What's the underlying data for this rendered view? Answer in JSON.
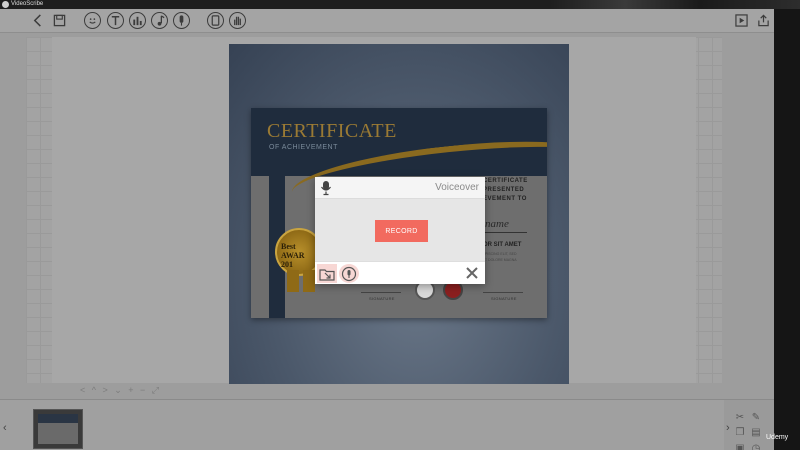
{
  "window": {
    "title": "VideoScribe"
  },
  "toolbar": {
    "left": [
      {
        "name": "back",
        "icon": "back-arrow-icon"
      },
      {
        "name": "save",
        "icon": "save-disk-icon"
      }
    ],
    "tools": [
      {
        "name": "add-image",
        "icon": "smiley-icon"
      },
      {
        "name": "add-text",
        "icon": "text-t-icon"
      },
      {
        "name": "add-chart",
        "icon": "bar-chart-icon"
      },
      {
        "name": "add-music",
        "icon": "music-note-icon"
      },
      {
        "name": "add-voiceover",
        "icon": "microphone-icon"
      },
      {
        "name": "background",
        "icon": "page-icon"
      },
      {
        "name": "hand",
        "icon": "hand-icon"
      }
    ],
    "right": [
      {
        "name": "play",
        "icon": "play-icon"
      },
      {
        "name": "publish",
        "icon": "share-upload-icon"
      }
    ]
  },
  "certificate": {
    "title": "CERTIFICATE",
    "subtitle": "OF ACHIEVEMENT",
    "right_lines": [
      "CERTIFICATE",
      "PRESENTED",
      "EVEMENT TO"
    ],
    "name": "name",
    "lorem": "OR SIT AMET",
    "small_lines": [
      "PISCING ELIT, SED",
      "T DOLORE MAGNA"
    ],
    "signature_label": "SIGNATURE",
    "medal_text": [
      "Best",
      "AWAR",
      "201"
    ]
  },
  "voiceover_dialog": {
    "title": "Voiceover",
    "record_label": "RECORD",
    "mic_icon": "microphone-icon",
    "footer_icons": [
      "folder-import-icon",
      "voice-record-icon"
    ],
    "close_icon": "close-x-icon"
  },
  "zoom": {
    "label": "< ^ > ⌄  + − ⤢"
  },
  "overlay": {
    "watermark": "Udemy"
  },
  "colors": {
    "record_button": "#f26a5f",
    "accent_gold": "#9a7a34",
    "dim_overlay": "#9a9a9a"
  }
}
